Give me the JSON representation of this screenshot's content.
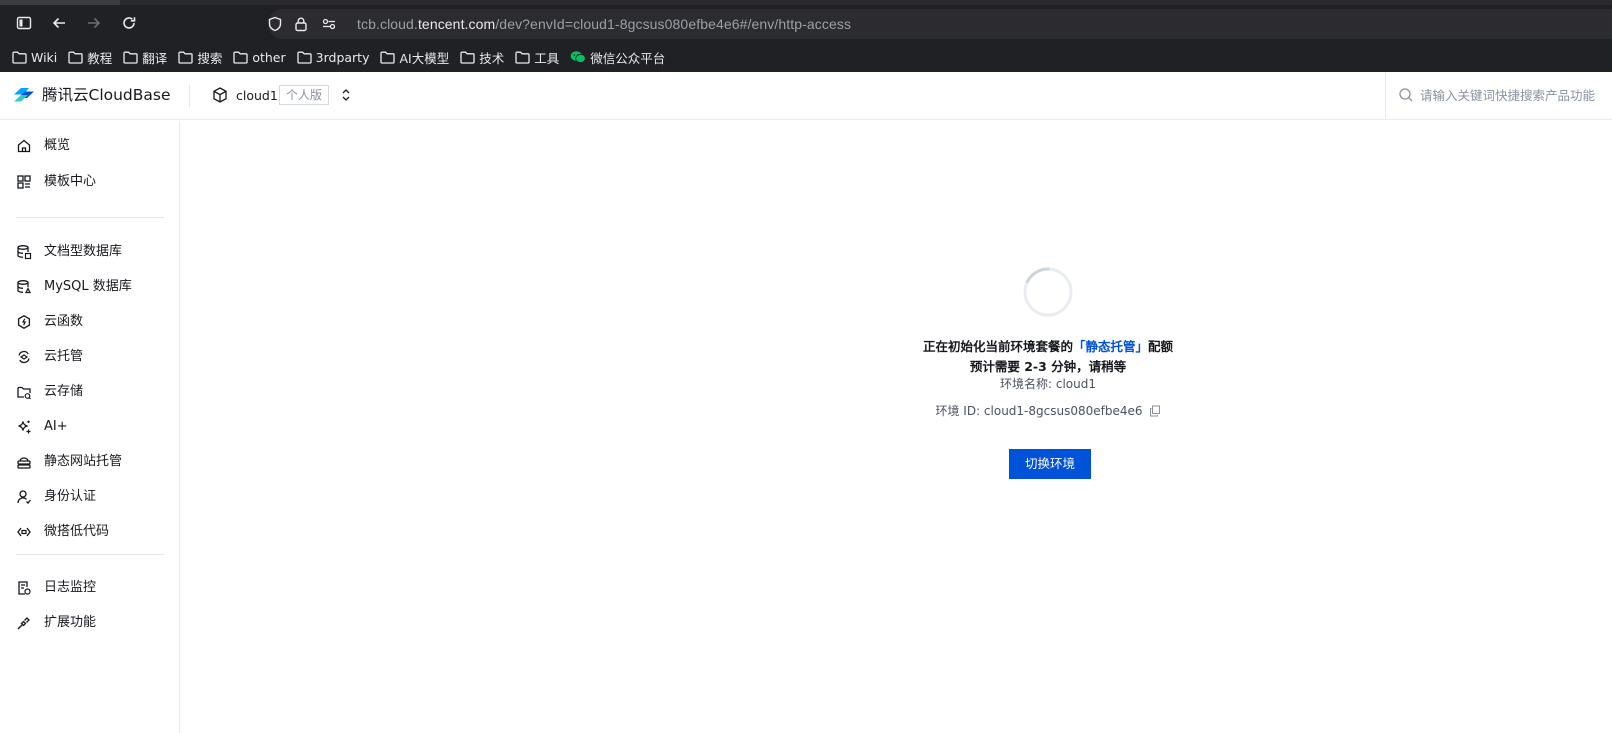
{
  "browser": {
    "url_prefix": "tcb.cloud.",
    "url_host": "tencent.com",
    "url_path": "/dev?envId=cloud1-8gcsus080efbe4e6#/env/http-access",
    "icons": [
      "sidebar-toggle-icon",
      "back-arrow-icon",
      "forward-arrow-icon",
      "reload-icon",
      "shield-icon",
      "lock-icon",
      "site-settings-icon"
    ],
    "bookmarks": [
      {
        "label": "Wiki",
        "icon": "folder-icon"
      },
      {
        "label": "教程",
        "icon": "folder-icon"
      },
      {
        "label": "翻译",
        "icon": "folder-icon"
      },
      {
        "label": "搜索",
        "icon": "folder-icon"
      },
      {
        "label": "other",
        "icon": "folder-icon"
      },
      {
        "label": "3rdparty",
        "icon": "folder-icon"
      },
      {
        "label": "AI大模型",
        "icon": "folder-icon"
      },
      {
        "label": "技术",
        "icon": "folder-icon"
      },
      {
        "label": "工具",
        "icon": "folder-icon"
      },
      {
        "label": "微信公众平台",
        "icon": "wechat-icon"
      }
    ]
  },
  "header": {
    "brand": "腾讯云CloudBase",
    "env_name": "cloud1",
    "plan": "个人版",
    "search_placeholder": "请输入关键词快捷搜索产品功能"
  },
  "sidebar": {
    "items": [
      {
        "label": "概览",
        "icon": "home-icon"
      },
      {
        "label": "模板中心",
        "icon": "template-grid-icon"
      },
      {
        "label": "文档型数据库",
        "icon": "document-database-icon"
      },
      {
        "label": "MySQL 数据库",
        "icon": "mysql-database-icon"
      },
      {
        "label": "云函数",
        "icon": "cloud-function-icon"
      },
      {
        "label": "云托管",
        "icon": "cloud-hosting-icon"
      },
      {
        "label": "云存储",
        "icon": "cloud-storage-icon"
      },
      {
        "label": "AI+",
        "icon": "ai-sparkle-icon"
      },
      {
        "label": "静态网站托管",
        "icon": "static-hosting-icon"
      },
      {
        "label": "身份认证",
        "icon": "identity-icon"
      },
      {
        "label": "微搭低代码",
        "icon": "lowcode-icon"
      },
      {
        "label": "日志监控",
        "icon": "log-monitor-icon"
      },
      {
        "label": "扩展功能",
        "icon": "extension-icon"
      }
    ]
  },
  "main": {
    "init_prefix": "正在初始化当前环境套餐的",
    "init_highlight": "「静态托管」",
    "init_suffix": "配额",
    "wait_text": "预计需要 2-3 分钟，请稍等",
    "env_name_label": "环境名称: ",
    "env_name_value": "cloud1",
    "env_id_label": "环境 ID: ",
    "env_id_value": "cloud1-8gcsus080efbe4e6",
    "switch_button": "切换环境"
  },
  "colors": {
    "primary": "#0052d9",
    "chrome_bg": "#202124",
    "wechat_green": "#07c160"
  }
}
